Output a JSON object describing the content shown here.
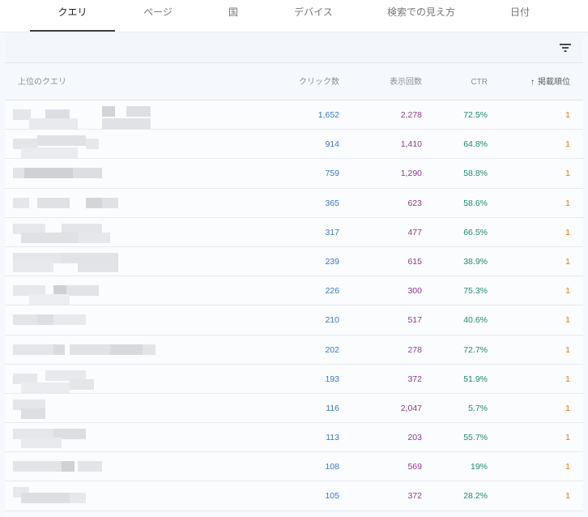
{
  "tabs": [
    {
      "label": "クエリ",
      "active": true
    },
    {
      "label": "ページ",
      "active": false
    },
    {
      "label": "国",
      "active": false
    },
    {
      "label": "デバイス",
      "active": false
    },
    {
      "label": "検索での見え方",
      "active": false
    },
    {
      "label": "日付",
      "active": false
    }
  ],
  "toolbar": {
    "filter_icon": "filter-icon"
  },
  "table": {
    "columns": {
      "query": "上位のクエリ",
      "clicks": "クリック数",
      "impressions": "表示回数",
      "ctr": "CTR",
      "position": "掲載順位",
      "sort_icon": "arrow-up-icon"
    },
    "rows": [
      {
        "clicks": "1,652",
        "impressions": "2,278",
        "ctr": "72.5%",
        "position": "1"
      },
      {
        "clicks": "914",
        "impressions": "1,410",
        "ctr": "64.8%",
        "position": "1"
      },
      {
        "clicks": "759",
        "impressions": "1,290",
        "ctr": "58.8%",
        "position": "1"
      },
      {
        "clicks": "365",
        "impressions": "623",
        "ctr": "58.6%",
        "position": "1"
      },
      {
        "clicks": "317",
        "impressions": "477",
        "ctr": "66.5%",
        "position": "1"
      },
      {
        "clicks": "239",
        "impressions": "615",
        "ctr": "38.9%",
        "position": "1"
      },
      {
        "clicks": "226",
        "impressions": "300",
        "ctr": "75.3%",
        "position": "1"
      },
      {
        "clicks": "210",
        "impressions": "517",
        "ctr": "40.6%",
        "position": "1"
      },
      {
        "clicks": "202",
        "impressions": "278",
        "ctr": "72.7%",
        "position": "1"
      },
      {
        "clicks": "193",
        "impressions": "372",
        "ctr": "51.9%",
        "position": "1"
      },
      {
        "clicks": "116",
        "impressions": "2,047",
        "ctr": "5.7%",
        "position": "1"
      },
      {
        "clicks": "113",
        "impressions": "203",
        "ctr": "55.7%",
        "position": "1"
      },
      {
        "clicks": "108",
        "impressions": "569",
        "ctr": "19%",
        "position": "1"
      },
      {
        "clicks": "105",
        "impressions": "372",
        "ctr": "28.2%",
        "position": "1"
      }
    ]
  },
  "colors": {
    "clicks": "#3b78c3",
    "impressions": "#8e3a8a",
    "ctr": "#1f8a70",
    "position": "#e8710a"
  }
}
